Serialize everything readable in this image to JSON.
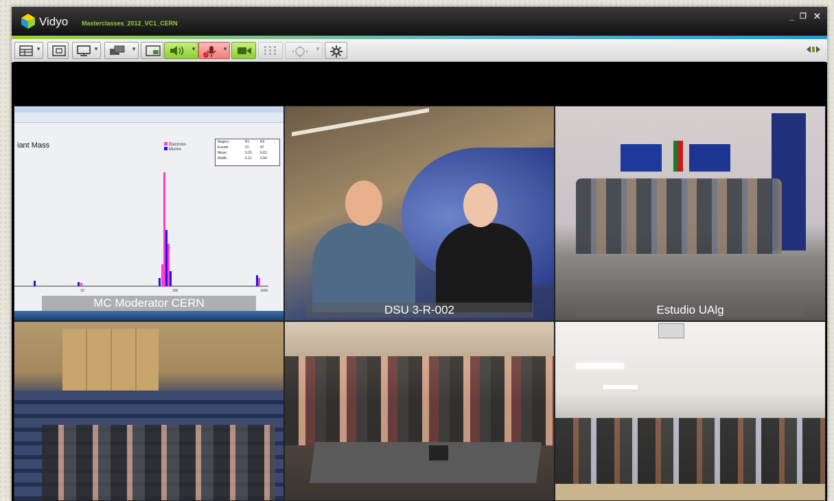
{
  "app": {
    "name": "Vidyo",
    "meeting": "Masterclasses_2012_VC1_CERN"
  },
  "window_controls": {
    "minimize": "_",
    "restore": "❐",
    "close": "✕"
  },
  "toolbar": {
    "buttons": [
      {
        "name": "layout-button",
        "icon": "grid-layout-icon"
      },
      {
        "name": "fullscreen-button",
        "icon": "fullscreen-icon"
      },
      {
        "name": "display-button",
        "icon": "monitor-icon"
      },
      {
        "name": "share-button",
        "icon": "share-screen-icon"
      },
      {
        "name": "self-view-button",
        "icon": "self-view-icon"
      },
      {
        "name": "speaker-button",
        "icon": "speaker-icon",
        "state": "on"
      },
      {
        "name": "microphone-button",
        "icon": "microphone-muted-icon",
        "state": "muted"
      },
      {
        "name": "camera-button",
        "icon": "camera-icon",
        "state": "on"
      },
      {
        "name": "dialpad-button",
        "icon": "dialpad-icon",
        "state": "disabled"
      },
      {
        "name": "camera-control-button",
        "icon": "camera-control-icon",
        "state": "disabled"
      },
      {
        "name": "settings-button",
        "icon": "gear-icon"
      }
    ],
    "right_icon": "collapse-icon"
  },
  "colors": {
    "accent_green": "#9bd032",
    "accent_blue": "#1e9ad6",
    "speaker_green": "#8fcb38",
    "mic_muted_red": "#f07d7d"
  },
  "participants": [
    {
      "label": "MC Moderator CERN",
      "shared_screen": {
        "plot_title": "iant Mass",
        "legend": [
          "Electrons",
          "Muons"
        ],
        "stats": {
          "rows": [
            [
              "Region:",
              "R1",
              "R2"
            ],
            [
              "Events:",
              "21",
              "47"
            ],
            [
              "Mean:",
              "5.03",
              "6.63"
            ],
            [
              "Width:",
              "0.12",
              "0.94"
            ]
          ]
        },
        "x_ticks": [
          "10",
          "100",
          "1000"
        ]
      }
    },
    {
      "label": "DSU 3-R-002"
    },
    {
      "label": "Estudio UAlg"
    },
    {
      "label": ""
    },
    {
      "label": ""
    },
    {
      "label": ""
    }
  ]
}
